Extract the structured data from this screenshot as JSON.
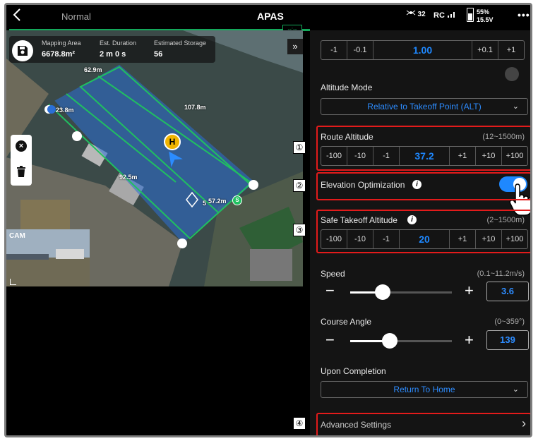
{
  "topbar": {
    "back_icon": "chevron-left-icon",
    "mode": "Normal",
    "title": "APAS",
    "gps_count": "32",
    "rc_label": "RC",
    "battery_percent": "55%",
    "battery_voltage": "15.5V",
    "more_icon": "ellipsis-icon"
  },
  "progress": {
    "end_label": "--:--"
  },
  "map": {
    "stats": {
      "area_label": "Mapping Area",
      "area_value": "6678.8m²",
      "duration_label": "Est. Duration",
      "duration_value": "2 m 0 s",
      "storage_label": "Estimated Storage",
      "storage_value": "56"
    },
    "edge_labels": {
      "top": "62.9m",
      "left": "23.8m",
      "right": "107.8m",
      "bottom": "92.5m",
      "lower_right": "57.2m",
      "small": "5"
    },
    "home_marker": "H",
    "start_marker": "S",
    "cam_label": "CAM",
    "expand_icon": "double-chevron-right-icon"
  },
  "panel": {
    "top_stepper": {
      "buttons_left": [
        "-1",
        "-0.1"
      ],
      "value": "1.00",
      "buttons_right": [
        "+0.1",
        "+1"
      ]
    },
    "altitude_mode": {
      "label": "Altitude Mode",
      "value": "Relative to Takeoff Point (ALT)"
    },
    "route_altitude": {
      "label": "Route Altitude",
      "range": "(12~1500m)",
      "buttons_left": [
        "-100",
        "-10",
        "-1"
      ],
      "value": "37.2",
      "buttons_right": [
        "+1",
        "+10",
        "+100"
      ]
    },
    "elevation_optimization": {
      "label": "Elevation Optimization",
      "info": "i",
      "enabled": true
    },
    "safe_takeoff": {
      "label": "Safe Takeoff Altitude",
      "info": "i",
      "range": "(2~1500m)",
      "buttons_left": [
        "-100",
        "-10",
        "-1"
      ],
      "value": "20",
      "buttons_right": [
        "+1",
        "+10",
        "+100"
      ]
    },
    "speed": {
      "label": "Speed",
      "range": "(0.1~11.2m/s)",
      "value": "3.6",
      "level": 0.32,
      "minus": "−",
      "plus": "+"
    },
    "course_angle": {
      "label": "Course Angle",
      "range": "(0~359°)",
      "value": "139",
      "level": 0.39,
      "minus": "−",
      "plus": "+"
    },
    "upon_completion": {
      "label": "Upon Completion",
      "value": "Return To Home"
    },
    "advanced": {
      "label": "Advanced Settings",
      "chevron": "›"
    }
  },
  "callouts": [
    "①",
    "②",
    "③",
    "④"
  ],
  "colors": {
    "accent": "#1e88ff",
    "highlight": "#e31b1b",
    "route": "#20c060",
    "area": "#2b6fd6"
  }
}
